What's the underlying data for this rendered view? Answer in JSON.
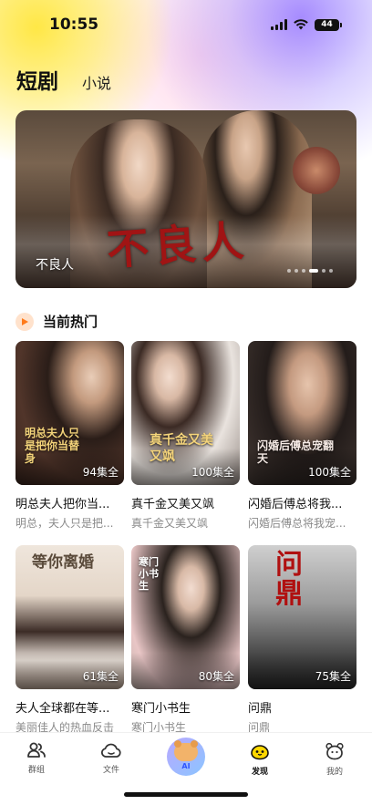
{
  "status_bar": {
    "time": "10:55",
    "battery": "44"
  },
  "top_tabs": {
    "active": "短剧",
    "other": "小说"
  },
  "banner": {
    "title": "不良人",
    "calligraphy": "不良人",
    "dots_count": 6,
    "active_dot": 3
  },
  "section": {
    "title": "当前热门"
  },
  "dramas": [
    {
      "name": "明总夫人把你当...",
      "desc": "明总，夫人只是把...",
      "episodes": "94集全",
      "poster_text": "明总夫人只是把你当替身"
    },
    {
      "name": "真千金又美又飒",
      "desc": "真千金又美又飒",
      "episodes": "100集全",
      "poster_text": "真千金又美又飒"
    },
    {
      "name": "闪婚后傅总将我...",
      "desc": "闪婚后傅总将我宠...",
      "episodes": "100集全",
      "poster_text": "闪婚后傅总宠翻天"
    },
    {
      "name": "夫人全球都在等...",
      "desc": "美丽佳人的热血反击",
      "episodes": "61集全",
      "poster_text": "等你离婚"
    },
    {
      "name": "寒门小书生",
      "desc": "寒门小书生",
      "episodes": "80集全",
      "poster_text": "寒门小书生"
    },
    {
      "name": "问鼎",
      "desc": "问鼎",
      "episodes": "75集全",
      "poster_text": "问鼎"
    }
  ],
  "bottom_tabs": [
    {
      "label": "群组",
      "icon": "group-icon"
    },
    {
      "label": "文件",
      "icon": "cloud-icon"
    },
    {
      "label": "AI",
      "icon": "ai-bear-icon"
    },
    {
      "label": "发现",
      "icon": "discover-icon",
      "active": true
    },
    {
      "label": "我的",
      "icon": "profile-icon"
    }
  ],
  "colors": {
    "accent": "#ff7a1a",
    "active_tab_icon": "#ffd800"
  }
}
